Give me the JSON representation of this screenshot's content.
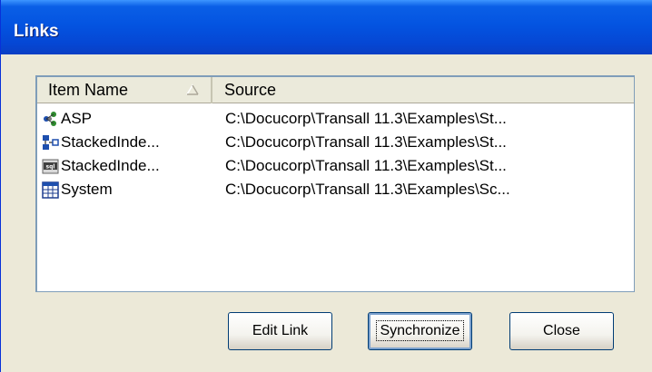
{
  "window": {
    "title": "Links"
  },
  "list": {
    "columns": [
      {
        "label": "Item Name",
        "sort_icon": "sort-ascending-icon"
      },
      {
        "label": "Source"
      }
    ],
    "rows": [
      {
        "name": "ASP",
        "source": "C:\\Docucorp\\Transall 11.3\\Examples\\St...",
        "icon": "asp-tree-icon"
      },
      {
        "name": "StackedInde...",
        "source": "C:\\Docucorp\\Transall 11.3\\Examples\\St...",
        "icon": "stacked-index-icon"
      },
      {
        "name": "StackedInde...",
        "source": "C:\\Docucorp\\Transall 11.3\\Examples\\St...",
        "icon": "sql-icon",
        "icon_text": "sql"
      },
      {
        "name": "System",
        "source": "C:\\Docucorp\\Transall 11.3\\Examples\\Sc...",
        "icon": "table-grid-icon"
      }
    ]
  },
  "buttons": {
    "edit_link": "Edit Link",
    "synchronize": "Synchronize",
    "close": "Close"
  },
  "colors": {
    "title_bar": "#0454e1",
    "dialog_face": "#ece9d8",
    "list_border": "#7f9db9"
  }
}
